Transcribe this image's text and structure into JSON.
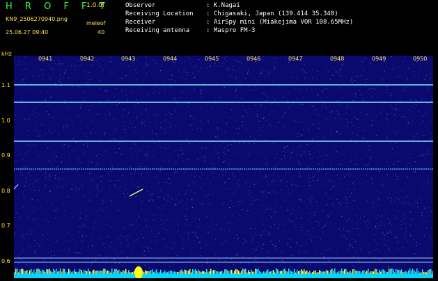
{
  "header": {
    "brand": "H R O F F T",
    "version": "1.0.0f",
    "filename": "KN9_2506270940.png",
    "datetime": "25.06.27 09:40",
    "meleo_label": "meleof",
    "meleo_value": "40",
    "info": [
      {
        "label": "Observer",
        "value": ": K.Nagai"
      },
      {
        "label": "Receiving Location",
        "value": ": Chigasaki, Japan (139.414 35.340)"
      },
      {
        "label": "Receiver",
        "value": ": AirSpy mini (Miakejima VOR 108.65MHz)"
      },
      {
        "label": "Receiving antenna",
        "value": ": Maspro FM-3"
      }
    ]
  },
  "axes": {
    "y_unit": "kHz",
    "y_ticks": [
      "1.1",
      "1.0",
      "0.9",
      "0.8",
      "0.7",
      "0.6"
    ],
    "x_ticks": [
      "0941",
      "0942",
      "0943",
      "0944",
      "0945",
      "0946",
      "0947",
      "0948",
      "0949",
      "0950"
    ]
  },
  "colors": {
    "background": "#0a0a6e",
    "trace": "#7fe6ff",
    "label": "#ffe24a",
    "brand": "#3dff3d"
  }
}
